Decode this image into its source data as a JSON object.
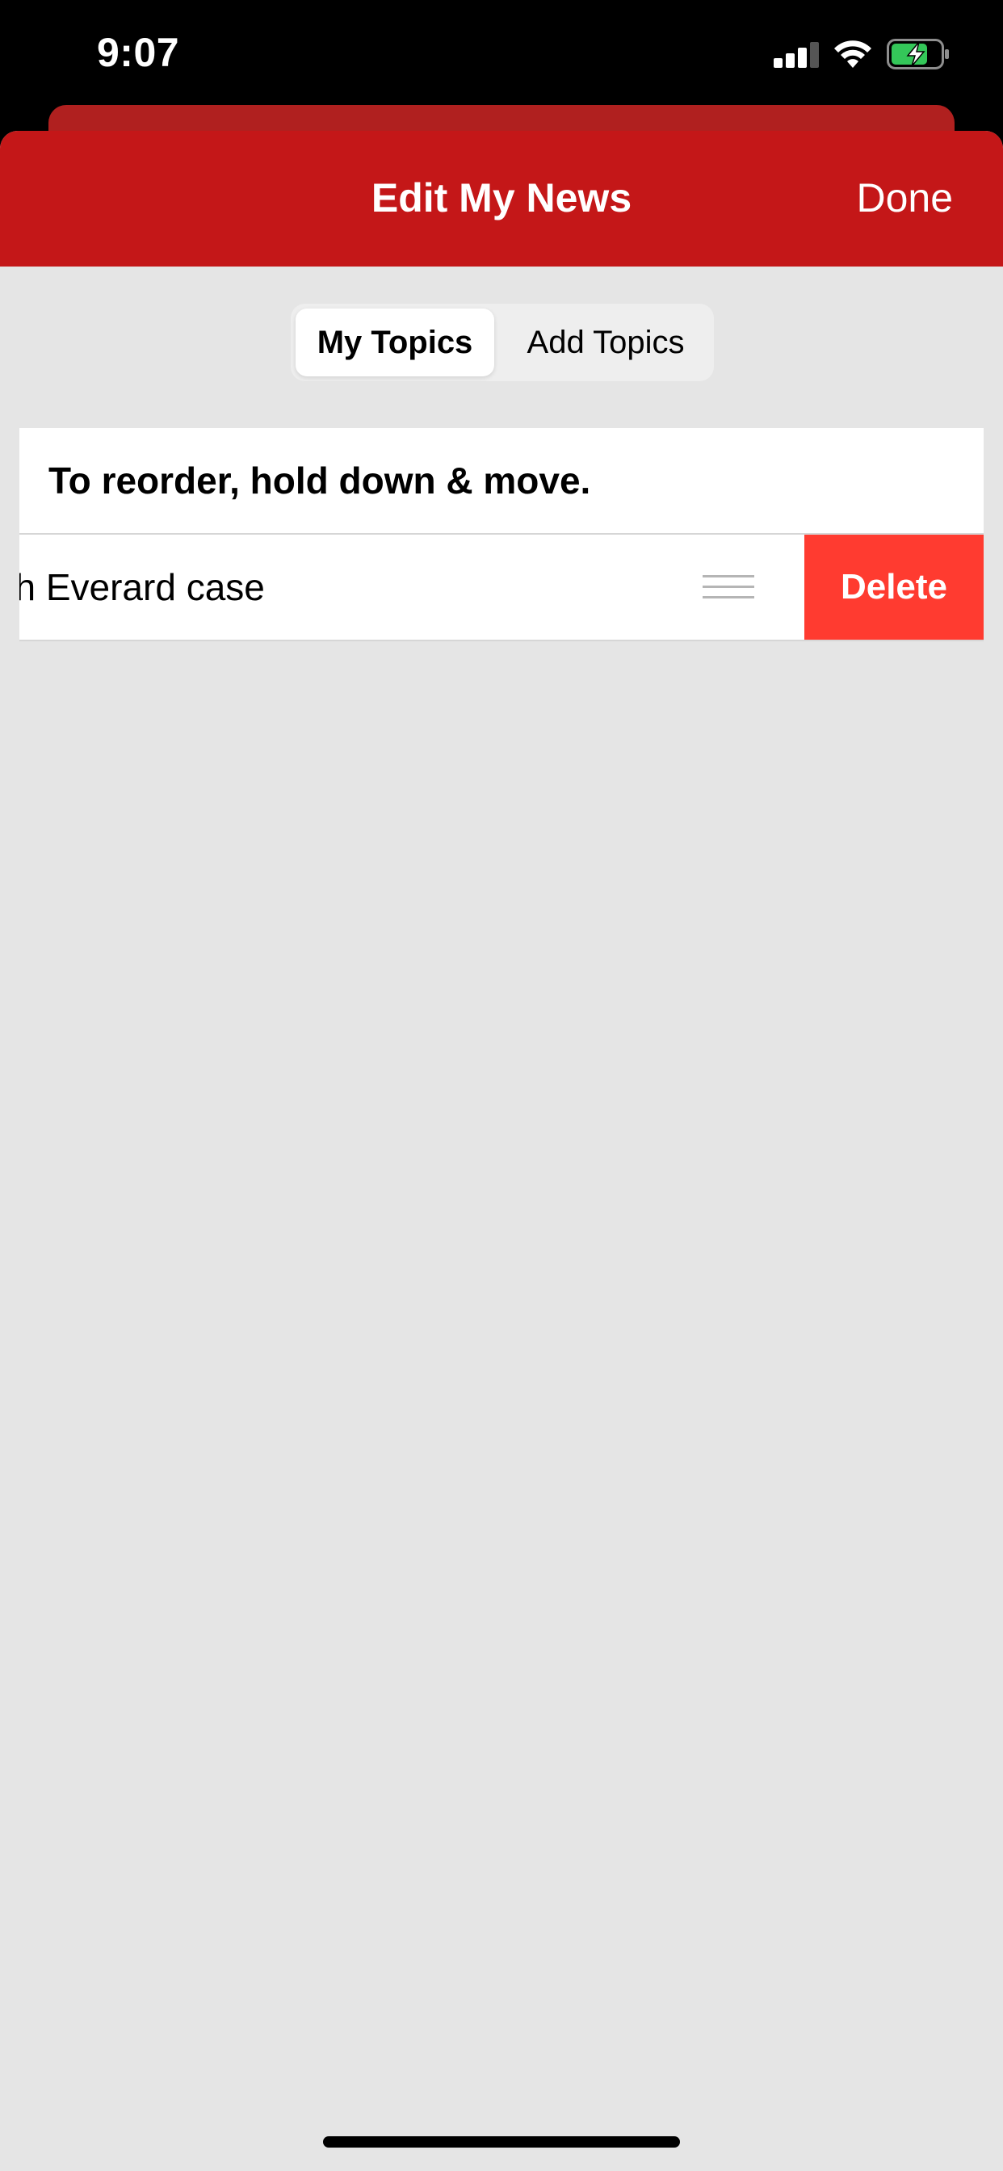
{
  "status_bar": {
    "time": "9:07",
    "icons": [
      "cellular-signal-icon",
      "wifi-icon",
      "battery-charging-icon"
    ],
    "battery_color": "#34c759"
  },
  "header": {
    "title": "Edit My News",
    "done_label": "Done",
    "background_color": "#c41718"
  },
  "tabs": {
    "my_topics": "My Topics",
    "add_topics": "Add Topics",
    "selected": "My Topics"
  },
  "list": {
    "header": "To reorder, hold down & move.",
    "items": [
      {
        "label": "arah Everard case",
        "delete_label": "Delete"
      }
    ],
    "delete_color": "#ff3b30"
  },
  "icons": {
    "drag_handle": "reorder-handle-icon"
  }
}
